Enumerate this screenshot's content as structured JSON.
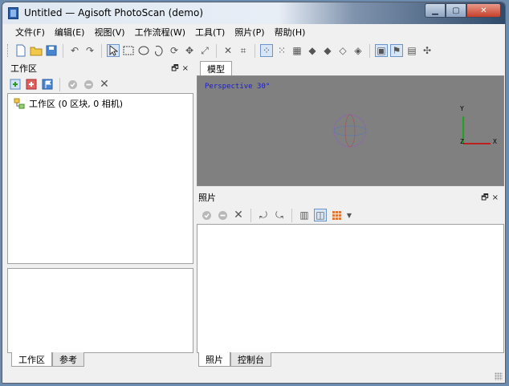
{
  "window": {
    "title": "Untitled — Agisoft PhotoScan (demo)"
  },
  "menu": {
    "items": [
      "文件(F)",
      "编辑(E)",
      "视图(V)",
      "工作流程(W)",
      "工具(T)",
      "照片(P)",
      "帮助(H)"
    ]
  },
  "workspace": {
    "title": "工作区",
    "tree_root": "工作区 (0 区块, 0 相机)",
    "tabs": [
      "工作区",
      "参考"
    ]
  },
  "model": {
    "tab": "模型",
    "perspective": "Perspective 30°",
    "axes": {
      "y": "Y",
      "x": "X",
      "z": "Z"
    }
  },
  "photos": {
    "title": "照片",
    "tabs": [
      "照片",
      "控制台"
    ]
  },
  "panel_controls": {
    "float": "🗗",
    "close": "×"
  },
  "colors": {
    "viewport_bg": "#808080",
    "axis_y": "#00b000",
    "axis_x": "#d00000",
    "perspective_text": "#1a1ad6"
  }
}
